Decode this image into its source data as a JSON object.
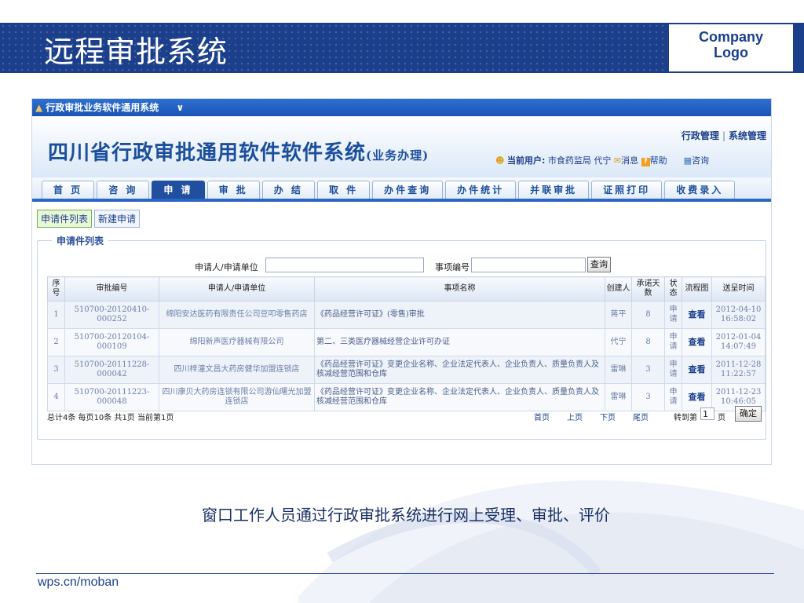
{
  "slide": {
    "title": "远程审批系统",
    "logo_line1": "Company",
    "logo_line2": "Logo",
    "caption": "窗口工作人员通过行政审批系统进行网上受理、审批、评价",
    "footer": "wps.cn/moban"
  },
  "window": {
    "title": "行政审批业务软件通用系统",
    "menu_arrow": "∨"
  },
  "header": {
    "system_title": "四川省行政审批通用软件软件系统",
    "system_subtitle": "(业务办理)",
    "link_admin": "行政管理",
    "link_system": "系统管理",
    "current_user_label": "当前用户:",
    "current_user_value": "市食药监局 代宁",
    "messages": "消息",
    "help": "帮助",
    "consult": "咨询"
  },
  "tabs": [
    {
      "label": "首 页",
      "active": false
    },
    {
      "label": "咨 询",
      "active": false
    },
    {
      "label": "申 请",
      "active": true
    },
    {
      "label": "审 批",
      "active": false
    },
    {
      "label": "办 结",
      "active": false
    },
    {
      "label": "取 件",
      "active": false
    },
    {
      "label": "办件查询",
      "active": false
    },
    {
      "label": "办件统计",
      "active": false
    },
    {
      "label": "并联审批",
      "active": false
    },
    {
      "label": "证照打印",
      "active": false
    },
    {
      "label": "收费录入",
      "active": false
    }
  ],
  "subtabs": [
    {
      "label": "申请件列表",
      "active": true
    },
    {
      "label": "新建申请",
      "active": false
    }
  ],
  "panel": {
    "legend": "申请件列表",
    "search_label_applicant": "申请人/申请单位",
    "search_label_item": "事项编号",
    "search_button": "查询"
  },
  "table": {
    "headers": [
      "序号",
      "审批编号",
      "申请人/申请单位",
      "事项名称",
      "创建人",
      "承诺天数",
      "状态",
      "流程图",
      "送呈时间"
    ],
    "rows": [
      {
        "no": "1",
        "code": "510700-20120410-000252",
        "applicant": "绵阳安达医药有限责任公司豆叩零售药店",
        "item": "《药品经营许可证》(零售)审批",
        "creator": "蒋平",
        "days": "8",
        "status": "申请",
        "flow": "查看",
        "time": "2012-04-10 16:58:02"
      },
      {
        "no": "2",
        "code": "510700-20120104-000109",
        "applicant": "绵阳新声医疗器械有限公司",
        "item": "第二、三类医疗器械经营企业许可办证",
        "creator": "代宁",
        "days": "8",
        "status": "申请",
        "flow": "查看",
        "time": "2012-01-04 14:07:49"
      },
      {
        "no": "3",
        "code": "510700-20111228-000042",
        "applicant": "四川梓潼文昌大药房健华加盟连锁店",
        "item": "《药品经营许可证》变更企业名称、企业法定代表人、企业负责人、质量负责人及核减经营范围和仓库",
        "creator": "雷琳",
        "days": "3",
        "status": "申请",
        "flow": "查看",
        "time": "2011-12-28 11:22:57"
      },
      {
        "no": "4",
        "code": "510700-20111223-000048",
        "applicant": "四川康贝大药房连锁有限公司游仙曙光加盟连锁店",
        "item": "《药品经营许可证》变更企业名称、企业法定代表人、企业负责人、质量负责人及核减经营范围和仓库",
        "creator": "雷琳",
        "days": "3",
        "status": "申请",
        "flow": "查看",
        "time": "2011-12-23 10:46:05"
      }
    ]
  },
  "pager": {
    "summary": "总计4条 每页10条 共1页 当前第1页",
    "first": "首页",
    "prev": "上页",
    "next": "下页",
    "last": "尾页",
    "goto_label": "转到第",
    "page_value": "1",
    "page_unit": "页",
    "ok": "确定"
  },
  "colors": {
    "banner": "#1c3f8c",
    "active_tab": "#1f4f9e",
    "nav_underline": "#2c66c4"
  }
}
